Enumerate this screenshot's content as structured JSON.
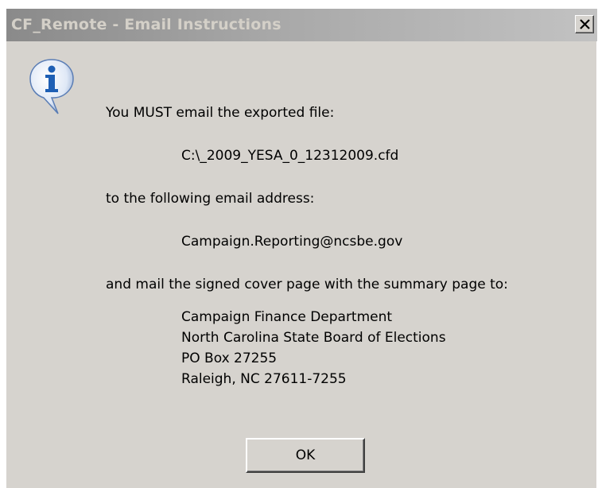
{
  "window": {
    "title": "CF_Remote - Email Instructions",
    "close_label": "×"
  },
  "message": {
    "line1": "You MUST email the exported file:",
    "file_path": "C:\\_2009_YESA_0_12312009.cfd",
    "line2": "to the following email address:",
    "email": "Campaign.Reporting@ncsbe.gov",
    "line3": "and mail the signed cover page with the summary page to:",
    "address": [
      "Campaign Finance Department",
      "North Carolina State Board of Elections",
      "PO Box 27255",
      "Raleigh, NC 27611-7255"
    ]
  },
  "buttons": {
    "ok_label": "OK"
  },
  "icons": {
    "info": "info-icon",
    "close": "close-icon"
  },
  "colors": {
    "window_bg": "#d6d3ce",
    "title_text": "#d4d0c8",
    "info_blue": "#1e5fb4"
  }
}
